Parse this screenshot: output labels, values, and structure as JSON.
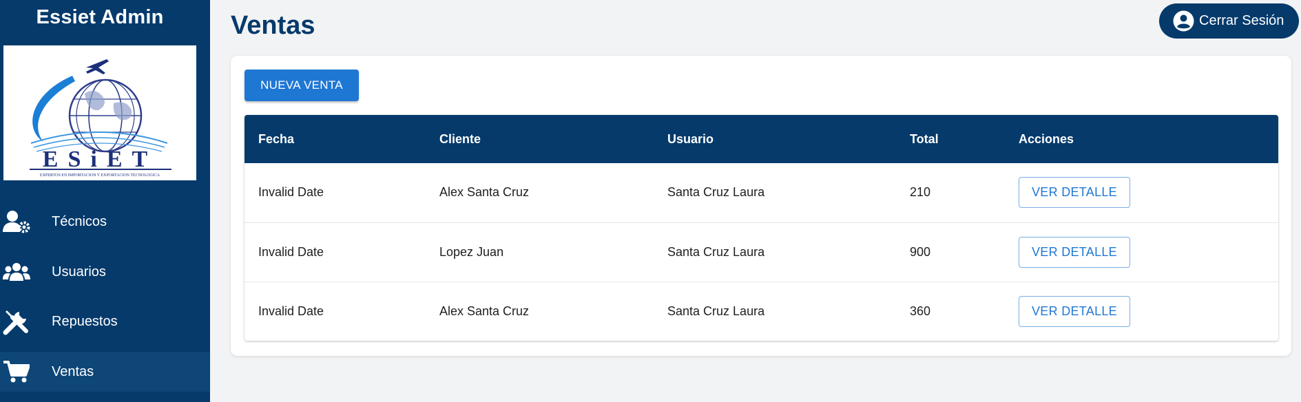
{
  "sidebar": {
    "brand": "Essiet Admin",
    "logo": {
      "text": "ESiET",
      "tagline": "EXPERTOS EN IMPORTACION Y EXPORTACION TECNOLOGICA"
    },
    "items": [
      {
        "label": "Técnicos",
        "icon": "user-gear-icon"
      },
      {
        "label": "Usuarios",
        "icon": "users-icon"
      },
      {
        "label": "Repuestos",
        "icon": "tools-icon"
      },
      {
        "label": "Ventas",
        "icon": "cart-icon",
        "active": true
      }
    ]
  },
  "header": {
    "title": "Ventas",
    "logout_label": "Cerrar Sesión",
    "logout_icon": "account-circle-icon"
  },
  "main": {
    "new_sale_label": "NUEVA VENTA",
    "table": {
      "columns": [
        "Fecha",
        "Cliente",
        "Usuario",
        "Total",
        "Acciones"
      ],
      "rows": [
        {
          "fecha": "Invalid Date",
          "cliente": "Alex Santa Cruz",
          "usuario": "Santa Cruz Laura",
          "total": "210",
          "action": "VER DETALLE"
        },
        {
          "fecha": "Invalid Date",
          "cliente": "Lopez Juan",
          "usuario": "Santa Cruz Laura",
          "total": "900",
          "action": "VER DETALLE"
        },
        {
          "fecha": "Invalid Date",
          "cliente": "Alex Santa Cruz",
          "usuario": "Santa Cruz Laura",
          "total": "360",
          "action": "VER DETALLE"
        }
      ]
    }
  },
  "colors": {
    "sidebar": "#053a6b",
    "accent": "#1f77d4",
    "background": "#f2f3f5"
  }
}
